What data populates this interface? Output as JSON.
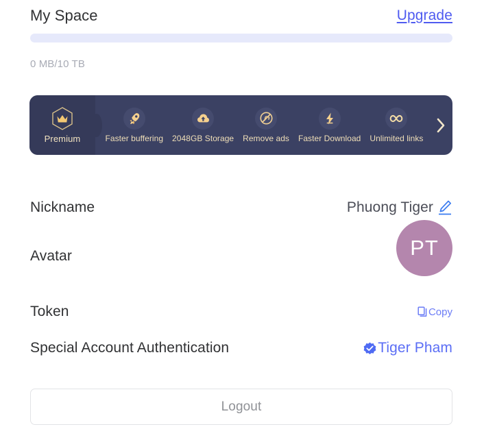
{
  "header": {
    "title": "My Space",
    "upgrade_label": "Upgrade"
  },
  "storage": {
    "used_text": "0 MB/10 TB",
    "percent": 0,
    "track_color": "#e6e9fb",
    "fill_color": "#4f5bf0"
  },
  "banner": {
    "background_color": "#3b4163",
    "tab_color": "#353a59",
    "accent_color": "#f0dfb8",
    "premium_label": "Premium",
    "premium_icon": "hexagon-crown-icon",
    "arrow_icon": "chevron-right-icon",
    "features": [
      {
        "label": "Faster buffering",
        "icon": "rocket-icon"
      },
      {
        "label": "2048GB Storage",
        "icon": "cloud-upload-icon"
      },
      {
        "label": "Remove ads",
        "icon": "no-ads-icon"
      },
      {
        "label": "Faster Download",
        "icon": "lightning-bolt-icon"
      },
      {
        "label": "Unlimited links",
        "icon": "infinity-icon"
      }
    ]
  },
  "rows": {
    "nickname": {
      "label": "Nickname",
      "value": "Phuong Tiger",
      "edit_icon": "pencil-edit-icon"
    },
    "avatar": {
      "label": "Avatar",
      "initials": "PT",
      "color": "#b486ad"
    },
    "token": {
      "label": "Token",
      "copy_label": "Copy",
      "copy_icon": "copy-icon"
    },
    "authentication": {
      "label": "Special Account Authentication",
      "value": "Tiger Pham",
      "verified_icon": "verified-badge-icon",
      "color": "#5b6ef5"
    }
  },
  "logout": {
    "label": "Logout"
  }
}
